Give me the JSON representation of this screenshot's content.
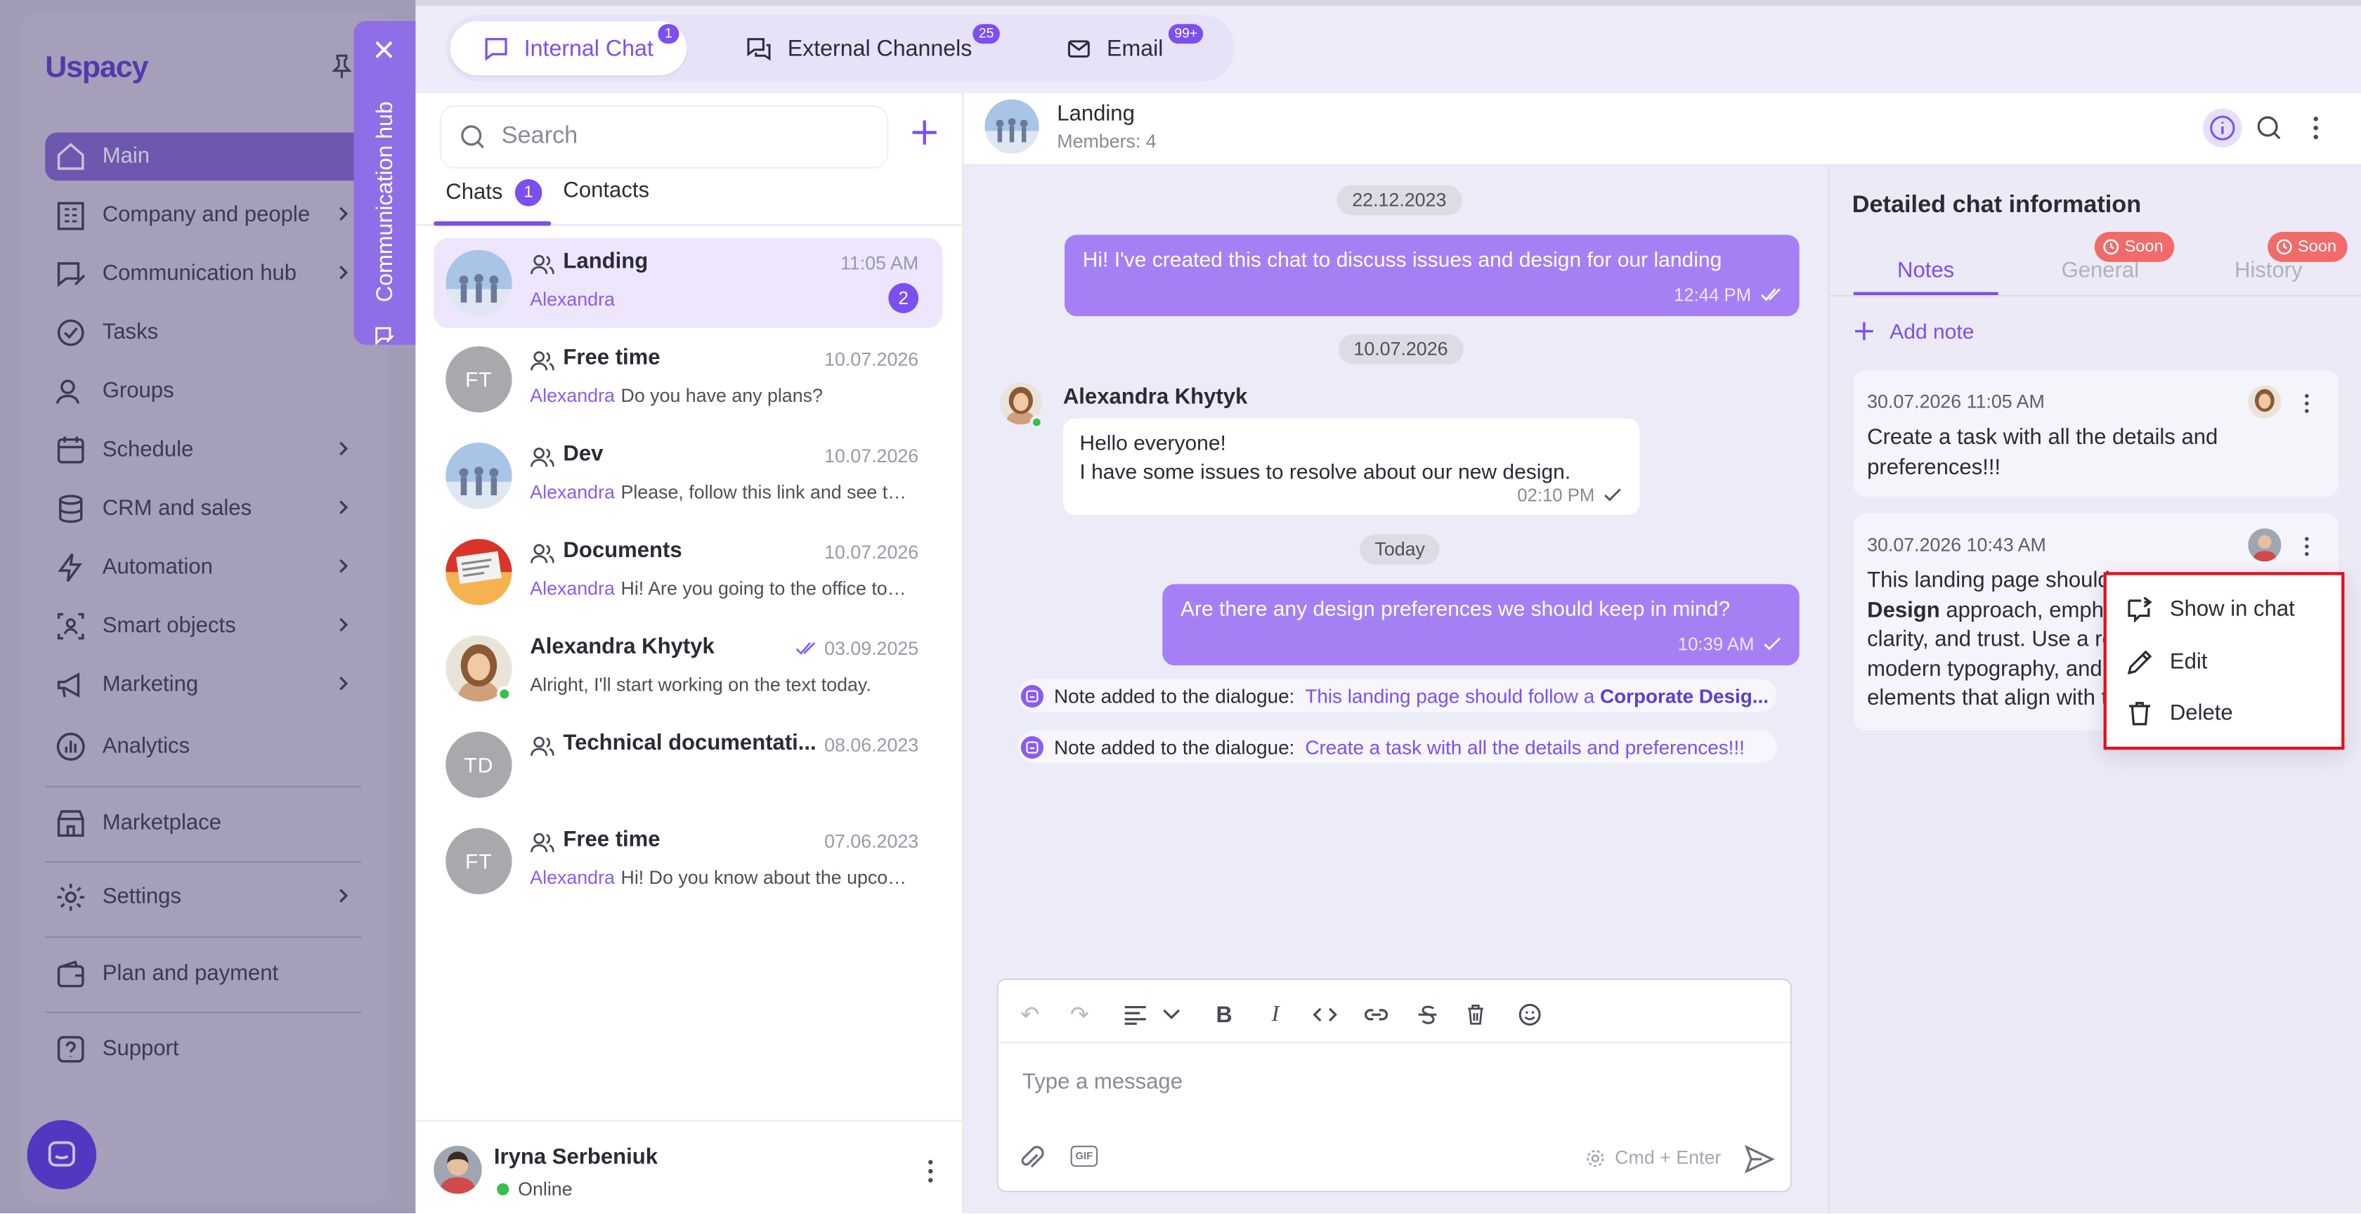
{
  "app": {
    "logo": "Uspacy"
  },
  "sidebar": {
    "items": [
      {
        "label": "Main",
        "icon": "home-icon",
        "active": true
      },
      {
        "label": "Company and people",
        "icon": "building-icon",
        "chevron": true
      },
      {
        "label": "Communication hub",
        "icon": "chat-edit-icon",
        "chevron": true
      },
      {
        "label": "Tasks",
        "icon": "check-circle-icon"
      },
      {
        "label": "Groups",
        "icon": "users-icon"
      },
      {
        "label": "Schedule",
        "icon": "calendar-icon",
        "chevron": true
      },
      {
        "label": "CRM and sales",
        "icon": "database-icon",
        "chevron": true
      },
      {
        "label": "Automation",
        "icon": "bolt-icon",
        "chevron": true
      },
      {
        "label": "Smart objects",
        "icon": "smart-object-icon",
        "chevron": true
      },
      {
        "label": "Marketing",
        "icon": "megaphone-icon",
        "chevron": true
      },
      {
        "label": "Analytics",
        "icon": "chart-icon"
      },
      {
        "label": "Marketplace",
        "icon": "store-icon"
      },
      {
        "label": "Settings",
        "icon": "gear-icon",
        "chevron": true
      },
      {
        "label": "Plan and payment",
        "icon": "wallet-icon"
      },
      {
        "label": "Support",
        "icon": "help-icon"
      }
    ]
  },
  "hub_tab": {
    "label": "Communication hub"
  },
  "top_tabs": [
    {
      "label": "Internal Chat",
      "badge": "1",
      "active": true
    },
    {
      "label": "External Channels",
      "badge": "25"
    },
    {
      "label": "Email",
      "badge": "99+"
    }
  ],
  "chatlist": {
    "search_placeholder": "Search",
    "tabs": {
      "chats": "Chats",
      "chats_count": "1",
      "contacts": "Contacts"
    },
    "items": [
      {
        "name": "Landing",
        "time": "11:05 AM",
        "sender": "Alexandra",
        "preview": "",
        "unread": "2",
        "group": true,
        "active": true
      },
      {
        "name": "Free time",
        "time": "10.07.2026",
        "sender": "Alexandra",
        "preview": "Do you have any plans?",
        "initials": "FT",
        "group": true
      },
      {
        "name": "Dev",
        "time": "10.07.2026",
        "sender": "Alexandra",
        "preview": "Please, follow this link and see th...",
        "group": true
      },
      {
        "name": "Documents",
        "time": "10.07.2026",
        "sender": "Alexandra",
        "preview": "Hi! Are you going to the office tod...",
        "group": true
      },
      {
        "name": "Alexandra Khytyk",
        "time": "03.09.2025",
        "sender": "",
        "preview": "Alright, I'll start working on the text today."
      },
      {
        "name": "Technical documentati...",
        "time": "08.06.2023",
        "sender": "",
        "preview": "",
        "initials": "TD",
        "group": true
      },
      {
        "name": "Free time",
        "time": "07.06.2023",
        "sender": "Alexandra",
        "preview": "Hi! Do you know about the upcom...",
        "initials": "FT",
        "group": true
      }
    ],
    "me": {
      "name": "Iryna Serbeniuk",
      "status": "Online"
    }
  },
  "conversation": {
    "title": "Landing",
    "members": "Members: 4",
    "date1": "22.12.2023",
    "msg1": {
      "text": "Hi! I've created this chat to discuss issues and design for our landing",
      "time": "12:44 PM"
    },
    "date2": "10.07.2026",
    "sender": "Alexandra Khytyk",
    "msg2": {
      "line1": "Hello everyone!",
      "line2": "I have some issues to resolve about our new design.",
      "time": "02:10 PM"
    },
    "date3": "Today",
    "msg3": {
      "text": "Are there any design preferences we should keep in mind?",
      "time": "10:39 AM"
    },
    "note1": {
      "prefix": "Note added to the dialogue:",
      "link": "This landing page should follow a ",
      "bold": "Corporate Desig..."
    },
    "note2": {
      "prefix": "Note added to the dialogue:",
      "link": "Create a task with all the details and preferences!!!"
    },
    "composer": {
      "placeholder": "Type a message",
      "hint": "Cmd + Enter",
      "gif": "GIF"
    }
  },
  "details": {
    "title": "Detailed chat information",
    "tabs": {
      "notes": "Notes",
      "general": "General",
      "history": "History",
      "soon": "Soon"
    },
    "add_note": "Add note",
    "note1": {
      "date": "30.07.2026 11:05 AM",
      "text": "Create a task with all the details and preferences!!!"
    },
    "note2": {
      "date": "30.07.2026 10:43 AM",
      "line1": "This landing page should",
      "bold": "Design",
      "line2": " approach, empha",
      "line3": "clarity, and trust. Use a re",
      "line4": "modern typography, and",
      "line5": "elements that align with t"
    }
  },
  "context_menu": {
    "show_in_chat": "Show in chat",
    "edit": "Edit",
    "delete": "Delete"
  },
  "colors": {
    "accent": "#7b4ff0",
    "bubble": "#a580f5",
    "soon": "#f26b6b",
    "highlight": "#e3101a"
  }
}
